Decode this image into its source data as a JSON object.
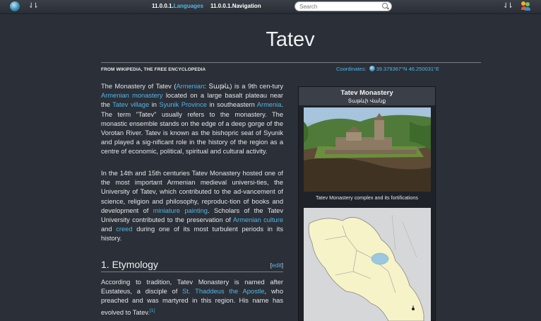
{
  "topbar": {
    "nav_languages_version": "11.0.0.1.",
    "nav_languages_label": "Languages",
    "nav_navigation_version": "11.0.0.1.",
    "nav_navigation_label": "Navigation",
    "search_placeholder": "Search",
    "arrows_left": "⇃⇂",
    "arrows_right": "⇃⇂"
  },
  "article": {
    "title": "Tatev",
    "from": "FROM WIKIPEDIA, THE FREE ENCYCLOPEDIA",
    "coordinates_label": "Coordinates:",
    "coordinates_value": "39.379367°N 46.250031°E",
    "p1": {
      "t1": "The Monastery of Tatev (",
      "l1": "Armenian",
      "t2": ": Տաթև) is a 9th cen-tury ",
      "l2": "Armenian monastery",
      "t3": " located on a large basalt plateau near the ",
      "l3": "Tatev village",
      "t4": " in ",
      "l4": "Syunik Province",
      "t5": " in southeastern ",
      "l5": "Armenia",
      "t6": ". The term \"Tatev\" usually refers to the monastery. The monastic ensemble stands on the edge of a deep gorge of the Vorotan River. Tatev is known as the bishopric seat of Syunik and played a sig-nificant role in the history of the region as a centre of economic, political, spiritual and cultural activity."
    },
    "p2": {
      "t1": "In the 14th and 15th centuries Tatev Monastery hosted one of the most important Armenian medieval universi-ties, the University of Tatev, which contributed to the ad-vancement of science, religion and philosophy, reproduc-tion of books and development of ",
      "l1": "miniature painting",
      "t2": ". Scholars of the Tatev University contributed to the preservation of ",
      "l2": "Armenian culture",
      "t3": " and ",
      "l3": "creed",
      "t4": " during one of its most turbulent periods in its history."
    },
    "section_heading": "1. Etymology",
    "edit_open": "[",
    "edit_label": "edit",
    "edit_close": "]",
    "p3": {
      "t1": "According to tradition, Tatev Monastery is named after Eustateus, a disciple of ",
      "l1": "St. Thaddeus the Apostle",
      "t2": ", who preached and was martyred in this region. His name has evolved to Tatev.",
      "ref": "[1]"
    }
  },
  "infobox": {
    "title": "Tatev Monastery",
    "subtitle": "Տաթևի Վանք",
    "caption": "Tatev Monastery complex and its fortifications",
    "colors": {
      "header_bg": "#3a3f48",
      "box_bg": "#1f2228",
      "link": "#4fb7e8"
    }
  }
}
